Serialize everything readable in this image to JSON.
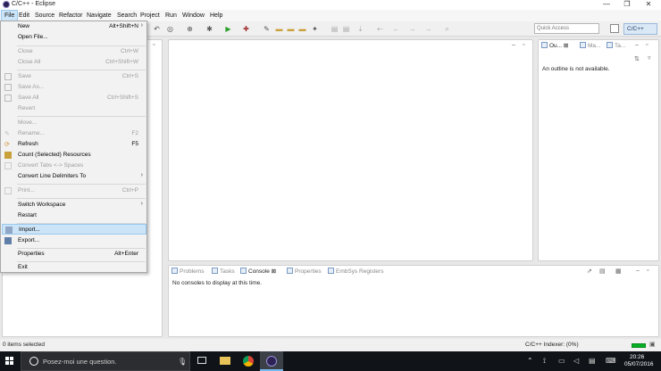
{
  "window": {
    "title": "C/C++ - Eclipse",
    "min": "—",
    "restore": "❐",
    "close": "✕"
  },
  "menubar": [
    "File",
    "Edit",
    "Source",
    "Refactor",
    "Navigate",
    "Search",
    "Project",
    "Run",
    "Window",
    "Help"
  ],
  "toolbar": {
    "quick_access_placeholder": "Quick Access",
    "perspective_label": "C/C++"
  },
  "file_menu": {
    "items": [
      {
        "label": "New",
        "shortcut": "Alt+Shift+N",
        "submenu": true
      },
      {
        "label": "Open File..."
      },
      {
        "label": "Close",
        "shortcut": "Ctrl+W",
        "disabled": true
      },
      {
        "label": "Close All",
        "shortcut": "Ctrl+Shift+W",
        "disabled": true
      },
      {
        "label": "Save",
        "shortcut": "Ctrl+S",
        "disabled": true
      },
      {
        "label": "Save As...",
        "disabled": true
      },
      {
        "label": "Save All",
        "shortcut": "Ctrl+Shift+S",
        "disabled": true
      },
      {
        "label": "Revert",
        "disabled": true
      },
      {
        "label": "Move...",
        "disabled": true
      },
      {
        "label": "Rename...",
        "shortcut": "F2",
        "disabled": true
      },
      {
        "label": "Refresh",
        "shortcut": "F5"
      },
      {
        "label": "Count (Selected) Resources"
      },
      {
        "label": "Convert Tabs <-> Spaces",
        "disabled": true
      },
      {
        "label": "Convert Line Delimiters To",
        "submenu": true
      },
      {
        "label": "Print...",
        "shortcut": "Ctrl+P",
        "disabled": true
      },
      {
        "label": "Switch Workspace",
        "submenu": true
      },
      {
        "label": "Restart"
      },
      {
        "label": "Import...",
        "highlighted": true
      },
      {
        "label": "Export..."
      },
      {
        "label": "Properties",
        "shortcut": "Alt+Enter"
      },
      {
        "label": "Exit"
      }
    ]
  },
  "outline": {
    "tabs": [
      "Ou...",
      "Ma...",
      "Ta..."
    ],
    "message": "An outline is not available."
  },
  "bottom_panel": {
    "tabs": [
      "Problems",
      "Tasks",
      "Console",
      "Properties",
      "EmbSys Registers"
    ],
    "active_tab": "Console",
    "message": "No consoles to display at this time."
  },
  "status": {
    "left": "0 items selected",
    "indexer": "C/C++ Indexer: (0%)",
    "indexer_progress": 1.0
  },
  "taskbar": {
    "search_placeholder": "Posez-moi une question.",
    "time": "20:26",
    "date": "05/07/2016"
  },
  "colors": {
    "menu_highlight": "#cce4f7",
    "taskbar": "#101418",
    "progress": "#06b025"
  }
}
